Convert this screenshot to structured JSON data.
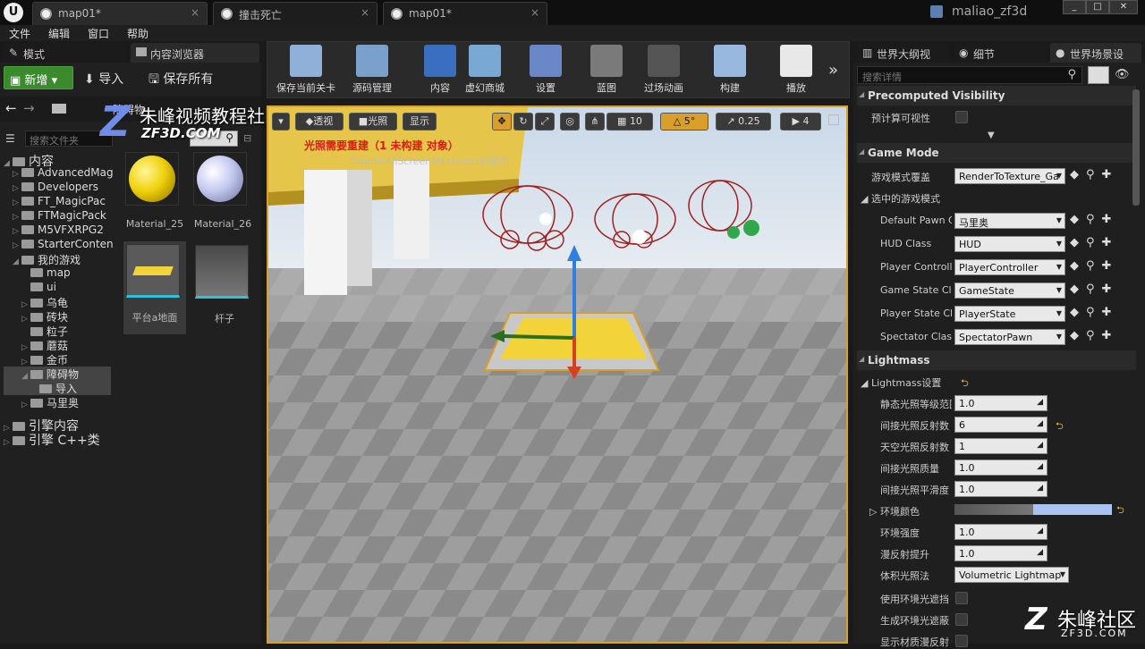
{
  "titlebar": {
    "tabs": [
      {
        "label": "map01*"
      },
      {
        "label": "撞击死亡"
      },
      {
        "label": "map01*"
      }
    ],
    "username": "maliao_zf3d"
  },
  "menu": [
    "文件",
    "编辑",
    "窗口",
    "帮助"
  ],
  "left_tabs": {
    "modes": "模式",
    "content_browser": "内容浏览器"
  },
  "content_browser": {
    "add_new": "新增",
    "import": "导入",
    "save_all": "保存所有",
    "search_placeholder": "搜索文件夹",
    "path_item": "障碍物",
    "tree": [
      {
        "label": "内容",
        "level": 0,
        "arrow": "◢"
      },
      {
        "label": "AdvancedMag",
        "level": 1,
        "arrow": "▷"
      },
      {
        "label": "Developers",
        "level": 1,
        "arrow": "▷"
      },
      {
        "label": "FT_MagicPac",
        "level": 1,
        "arrow": "▷"
      },
      {
        "label": "FTMagicPack",
        "level": 1,
        "arrow": "▷"
      },
      {
        "label": "M5VFXRPG2",
        "level": 1,
        "arrow": "▷"
      },
      {
        "label": "StarterConten",
        "level": 1,
        "arrow": "▷"
      },
      {
        "label": "我的游戏",
        "level": 1,
        "arrow": "◢"
      },
      {
        "label": "map",
        "level": 2,
        "arrow": ""
      },
      {
        "label": "ui",
        "level": 2,
        "arrow": ""
      },
      {
        "label": "乌龟",
        "level": 2,
        "arrow": "▷"
      },
      {
        "label": "砖块",
        "level": 2,
        "arrow": "▷"
      },
      {
        "label": "粒子",
        "level": 2,
        "arrow": ""
      },
      {
        "label": "蘑菇",
        "level": 2,
        "arrow": "▷"
      },
      {
        "label": "金币",
        "level": 2,
        "arrow": "▷"
      },
      {
        "label": "障碍物",
        "level": 2,
        "arrow": "◢"
      },
      {
        "label": "导入",
        "level": 3,
        "arrow": ""
      },
      {
        "label": "马里奥",
        "level": 2,
        "arrow": "▷"
      },
      {
        "label": "引擎内容",
        "level": 0,
        "arrow": "▷"
      },
      {
        "label": "引擎 C++类",
        "level": 0,
        "arrow": "▷"
      }
    ],
    "assets": [
      {
        "label": "Material_25"
      },
      {
        "label": "Material_26"
      },
      {
        "label": "平台a地面"
      },
      {
        "label": "杆子"
      }
    ]
  },
  "toolbar": [
    {
      "label": "保存当前关卡",
      "icon": "save-icon"
    },
    {
      "label": "源码管理",
      "icon": "source-control-icon"
    },
    {
      "label": "内容",
      "icon": "content-icon"
    },
    {
      "label": "虚幻商城",
      "icon": "marketplace-icon"
    },
    {
      "label": "设置",
      "icon": "settings-icon"
    },
    {
      "label": "蓝图",
      "icon": "blueprint-icon"
    },
    {
      "label": "过场动画",
      "icon": "cinematics-icon"
    },
    {
      "label": "构建",
      "icon": "build-icon"
    },
    {
      "label": "播放",
      "icon": "play-icon"
    }
  ],
  "viewport": {
    "perspective": "透视",
    "lighting": "光照",
    "show": "显示",
    "grid_snap": "10",
    "rot_snap": "5°",
    "scale_snap": "0.25",
    "cam_speed": "4",
    "warning": "光照需要重建（1 未构建 对象）",
    "overlay_text": "DisableAllScreenMessages以禁用"
  },
  "watermark": {
    "title": "朱峰视频教程社区",
    "url": "ZF3D.COM",
    "corner": "朱峰社区",
    "corner_url": "ZF3D.COM"
  },
  "right_tabs": {
    "outliner": "世界大纲视",
    "details": "细节",
    "world_settings": "世界场景设"
  },
  "details": {
    "search_placeholder": "搜索详情",
    "cat_precomputed": "Precomputed Visibility",
    "precomputed_label": "预计算可视性",
    "cat_gamemode": "Game Mode",
    "gm_override_label": "游戏模式覆盖",
    "gm_override_value": "RenderToTexture_Ga",
    "selected_gm": "选中的游戏模式",
    "gm_props": [
      {
        "label": "Default Pawn Cl",
        "value": "马里奥"
      },
      {
        "label": "HUD Class",
        "value": "HUD"
      },
      {
        "label": "Player Controlle",
        "value": "PlayerController"
      },
      {
        "label": "Game State Cla",
        "value": "GameState"
      },
      {
        "label": "Player State Cla",
        "value": "PlayerState"
      },
      {
        "label": "Spectator Class",
        "value": "SpectatorPawn"
      }
    ],
    "cat_lightmass": "Lightmass",
    "lm_settings": "Lightmass设置",
    "lm_props": [
      {
        "label": "静态光照等级范围",
        "value": "1.0"
      },
      {
        "label": "间接光照反射数",
        "value": "6"
      },
      {
        "label": "天空光照反射数",
        "value": "1"
      },
      {
        "label": "间接光照质量",
        "value": "1.0"
      },
      {
        "label": "间接光照平滑度",
        "value": "1.0"
      }
    ],
    "env_color": "环境颜色",
    "lm_props2": [
      {
        "label": "环境强度",
        "value": "1.0"
      },
      {
        "label": "漫反射提升",
        "value": "1.0"
      }
    ],
    "vol_label": "体积光照法",
    "vol_value": "Volumetric Lightmap",
    "check_labels": [
      "使用环境光遮挡",
      "生成环境光遮蔽",
      "显示材质漫反射"
    ]
  },
  "colors": {
    "accent": "#d89f2a",
    "green": "#3c8a2e",
    "sky": "#a9c3f2"
  }
}
